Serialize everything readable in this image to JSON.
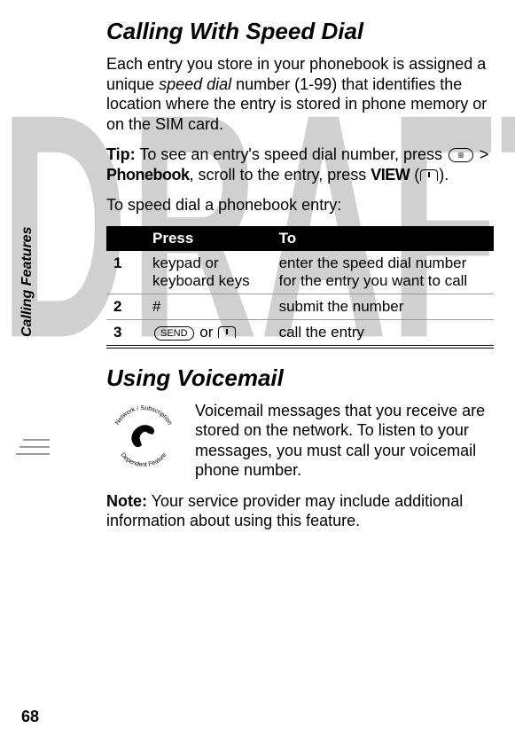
{
  "watermark": "DRAFT",
  "side_label": "Calling Features",
  "page_number": "68",
  "sections": {
    "speed_dial": {
      "heading": "Calling With Speed Dial",
      "intro_before": "Each entry you store in your phonebook is assigned a unique ",
      "intro_italic": "speed dial",
      "intro_after": " number (1-99) that identifies the location where the entry is stored in phone memory or on the SIM card.",
      "tip_label": "Tip:",
      "tip_text_1": " To see an entry's speed dial number, press ",
      "tip_menu_key": "≡",
      "tip_gt": " > ",
      "tip_phonebook": "Phonebook",
      "tip_text_2": ", scroll to the entry, press ",
      "tip_view": "VIEW",
      "tip_text_3": ").",
      "lead": "To speed dial a phonebook entry:",
      "table": {
        "head_empty": "",
        "head_press": "Press",
        "head_to": "To",
        "rows": [
          {
            "n": "1",
            "press": "keypad or keyboard keys",
            "to": "enter the speed dial number for the entry you want to call"
          },
          {
            "n": "2",
            "press": "#",
            "to": "submit the number"
          },
          {
            "n": "3",
            "press_prefix": "",
            "send_key": "SEND",
            "press_or": " or ",
            "softkey": true,
            "to": "call the entry"
          }
        ]
      }
    },
    "voicemail": {
      "heading": "Using Voicemail",
      "icon_ring_top": "Network / Subscription",
      "icon_ring_bottom": "Dependent Feature",
      "body": "Voicemail messages that you receive are stored on the network. To listen to your messages, you must call your voicemail phone number.",
      "note_label": "Note:",
      "note_text": " Your service provider may include additional information about using this feature."
    }
  }
}
